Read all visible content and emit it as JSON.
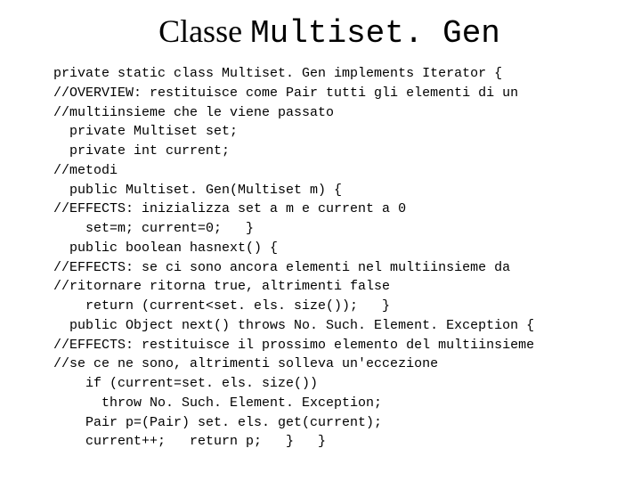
{
  "title": {
    "serif": "Classe ",
    "mono": "Multiset. Gen"
  },
  "code": "private static class Multiset. Gen implements Iterator {\n//OVERVIEW: restituisce come Pair tutti gli elementi di un\n//multiinsieme che le viene passato\n  private Multiset set;\n  private int current;\n//metodi\n  public Multiset. Gen(Multiset m) {\n//EFFECTS: inizializza set a m e current a 0\n    set=m; current=0;   }\n  public boolean hasnext() {\n//EFFECTS: se ci sono ancora elementi nel multiinsieme da\n//ritornare ritorna true, altrimenti false\n    return (current<set. els. size());   }\n  public Object next() throws No. Such. Element. Exception {\n//EFFECTS: restituisce il prossimo elemento del multiinsieme\n//se ce ne sono, altrimenti solleva un'eccezione\n    if (current=set. els. size())\n      throw No. Such. Element. Exception;\n    Pair p=(Pair) set. els. get(current);\n    current++;   return p;   }   }"
}
